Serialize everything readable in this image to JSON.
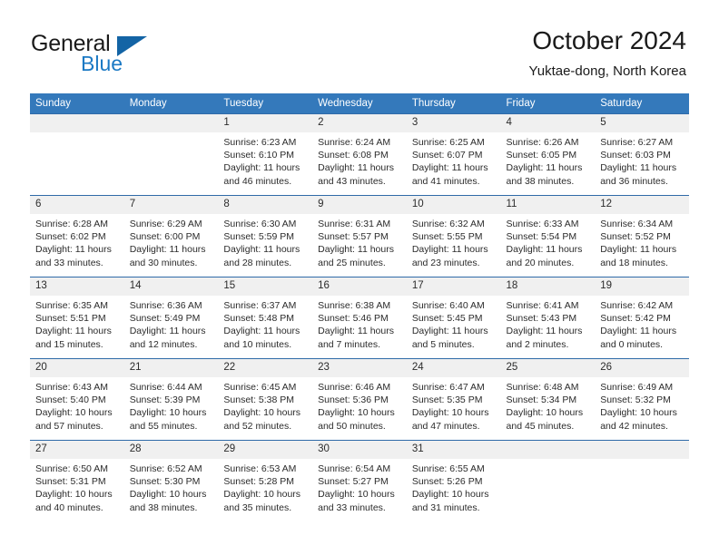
{
  "brand": {
    "name_part1": "General",
    "name_part2": "Blue"
  },
  "header": {
    "title": "October 2024",
    "location": "Yuktae-dong, North Korea"
  },
  "calendar": {
    "weekday_headers": [
      "Sunday",
      "Monday",
      "Tuesday",
      "Wednesday",
      "Thursday",
      "Friday",
      "Saturday"
    ],
    "colors": {
      "header_bg": "#3479bb",
      "row_border": "#2f6aa8",
      "daynum_bg": "#f0f0f0",
      "brand_blue": "#1b79c4",
      "brand_dark": "#1a1a1a"
    },
    "weeks": [
      [
        {
          "day": "",
          "sunrise": "",
          "sunset": "",
          "daylight_line1": "",
          "daylight_line2": ""
        },
        {
          "day": "",
          "sunrise": "",
          "sunset": "",
          "daylight_line1": "",
          "daylight_line2": ""
        },
        {
          "day": "1",
          "sunrise": "Sunrise: 6:23 AM",
          "sunset": "Sunset: 6:10 PM",
          "daylight_line1": "Daylight: 11 hours",
          "daylight_line2": "and 46 minutes."
        },
        {
          "day": "2",
          "sunrise": "Sunrise: 6:24 AM",
          "sunset": "Sunset: 6:08 PM",
          "daylight_line1": "Daylight: 11 hours",
          "daylight_line2": "and 43 minutes."
        },
        {
          "day": "3",
          "sunrise": "Sunrise: 6:25 AM",
          "sunset": "Sunset: 6:07 PM",
          "daylight_line1": "Daylight: 11 hours",
          "daylight_line2": "and 41 minutes."
        },
        {
          "day": "4",
          "sunrise": "Sunrise: 6:26 AM",
          "sunset": "Sunset: 6:05 PM",
          "daylight_line1": "Daylight: 11 hours",
          "daylight_line2": "and 38 minutes."
        },
        {
          "day": "5",
          "sunrise": "Sunrise: 6:27 AM",
          "sunset": "Sunset: 6:03 PM",
          "daylight_line1": "Daylight: 11 hours",
          "daylight_line2": "and 36 minutes."
        }
      ],
      [
        {
          "day": "6",
          "sunrise": "Sunrise: 6:28 AM",
          "sunset": "Sunset: 6:02 PM",
          "daylight_line1": "Daylight: 11 hours",
          "daylight_line2": "and 33 minutes."
        },
        {
          "day": "7",
          "sunrise": "Sunrise: 6:29 AM",
          "sunset": "Sunset: 6:00 PM",
          "daylight_line1": "Daylight: 11 hours",
          "daylight_line2": "and 30 minutes."
        },
        {
          "day": "8",
          "sunrise": "Sunrise: 6:30 AM",
          "sunset": "Sunset: 5:59 PM",
          "daylight_line1": "Daylight: 11 hours",
          "daylight_line2": "and 28 minutes."
        },
        {
          "day": "9",
          "sunrise": "Sunrise: 6:31 AM",
          "sunset": "Sunset: 5:57 PM",
          "daylight_line1": "Daylight: 11 hours",
          "daylight_line2": "and 25 minutes."
        },
        {
          "day": "10",
          "sunrise": "Sunrise: 6:32 AM",
          "sunset": "Sunset: 5:55 PM",
          "daylight_line1": "Daylight: 11 hours",
          "daylight_line2": "and 23 minutes."
        },
        {
          "day": "11",
          "sunrise": "Sunrise: 6:33 AM",
          "sunset": "Sunset: 5:54 PM",
          "daylight_line1": "Daylight: 11 hours",
          "daylight_line2": "and 20 minutes."
        },
        {
          "day": "12",
          "sunrise": "Sunrise: 6:34 AM",
          "sunset": "Sunset: 5:52 PM",
          "daylight_line1": "Daylight: 11 hours",
          "daylight_line2": "and 18 minutes."
        }
      ],
      [
        {
          "day": "13",
          "sunrise": "Sunrise: 6:35 AM",
          "sunset": "Sunset: 5:51 PM",
          "daylight_line1": "Daylight: 11 hours",
          "daylight_line2": "and 15 minutes."
        },
        {
          "day": "14",
          "sunrise": "Sunrise: 6:36 AM",
          "sunset": "Sunset: 5:49 PM",
          "daylight_line1": "Daylight: 11 hours",
          "daylight_line2": "and 12 minutes."
        },
        {
          "day": "15",
          "sunrise": "Sunrise: 6:37 AM",
          "sunset": "Sunset: 5:48 PM",
          "daylight_line1": "Daylight: 11 hours",
          "daylight_line2": "and 10 minutes."
        },
        {
          "day": "16",
          "sunrise": "Sunrise: 6:38 AM",
          "sunset": "Sunset: 5:46 PM",
          "daylight_line1": "Daylight: 11 hours",
          "daylight_line2": "and 7 minutes."
        },
        {
          "day": "17",
          "sunrise": "Sunrise: 6:40 AM",
          "sunset": "Sunset: 5:45 PM",
          "daylight_line1": "Daylight: 11 hours",
          "daylight_line2": "and 5 minutes."
        },
        {
          "day": "18",
          "sunrise": "Sunrise: 6:41 AM",
          "sunset": "Sunset: 5:43 PM",
          "daylight_line1": "Daylight: 11 hours",
          "daylight_line2": "and 2 minutes."
        },
        {
          "day": "19",
          "sunrise": "Sunrise: 6:42 AM",
          "sunset": "Sunset: 5:42 PM",
          "daylight_line1": "Daylight: 11 hours",
          "daylight_line2": "and 0 minutes."
        }
      ],
      [
        {
          "day": "20",
          "sunrise": "Sunrise: 6:43 AM",
          "sunset": "Sunset: 5:40 PM",
          "daylight_line1": "Daylight: 10 hours",
          "daylight_line2": "and 57 minutes."
        },
        {
          "day": "21",
          "sunrise": "Sunrise: 6:44 AM",
          "sunset": "Sunset: 5:39 PM",
          "daylight_line1": "Daylight: 10 hours",
          "daylight_line2": "and 55 minutes."
        },
        {
          "day": "22",
          "sunrise": "Sunrise: 6:45 AM",
          "sunset": "Sunset: 5:38 PM",
          "daylight_line1": "Daylight: 10 hours",
          "daylight_line2": "and 52 minutes."
        },
        {
          "day": "23",
          "sunrise": "Sunrise: 6:46 AM",
          "sunset": "Sunset: 5:36 PM",
          "daylight_line1": "Daylight: 10 hours",
          "daylight_line2": "and 50 minutes."
        },
        {
          "day": "24",
          "sunrise": "Sunrise: 6:47 AM",
          "sunset": "Sunset: 5:35 PM",
          "daylight_line1": "Daylight: 10 hours",
          "daylight_line2": "and 47 minutes."
        },
        {
          "day": "25",
          "sunrise": "Sunrise: 6:48 AM",
          "sunset": "Sunset: 5:34 PM",
          "daylight_line1": "Daylight: 10 hours",
          "daylight_line2": "and 45 minutes."
        },
        {
          "day": "26",
          "sunrise": "Sunrise: 6:49 AM",
          "sunset": "Sunset: 5:32 PM",
          "daylight_line1": "Daylight: 10 hours",
          "daylight_line2": "and 42 minutes."
        }
      ],
      [
        {
          "day": "27",
          "sunrise": "Sunrise: 6:50 AM",
          "sunset": "Sunset: 5:31 PM",
          "daylight_line1": "Daylight: 10 hours",
          "daylight_line2": "and 40 minutes."
        },
        {
          "day": "28",
          "sunrise": "Sunrise: 6:52 AM",
          "sunset": "Sunset: 5:30 PM",
          "daylight_line1": "Daylight: 10 hours",
          "daylight_line2": "and 38 minutes."
        },
        {
          "day": "29",
          "sunrise": "Sunrise: 6:53 AM",
          "sunset": "Sunset: 5:28 PM",
          "daylight_line1": "Daylight: 10 hours",
          "daylight_line2": "and 35 minutes."
        },
        {
          "day": "30",
          "sunrise": "Sunrise: 6:54 AM",
          "sunset": "Sunset: 5:27 PM",
          "daylight_line1": "Daylight: 10 hours",
          "daylight_line2": "and 33 minutes."
        },
        {
          "day": "31",
          "sunrise": "Sunrise: 6:55 AM",
          "sunset": "Sunset: 5:26 PM",
          "daylight_line1": "Daylight: 10 hours",
          "daylight_line2": "and 31 minutes."
        },
        {
          "day": "",
          "sunrise": "",
          "sunset": "",
          "daylight_line1": "",
          "daylight_line2": ""
        },
        {
          "day": "",
          "sunrise": "",
          "sunset": "",
          "daylight_line1": "",
          "daylight_line2": ""
        }
      ]
    ]
  }
}
